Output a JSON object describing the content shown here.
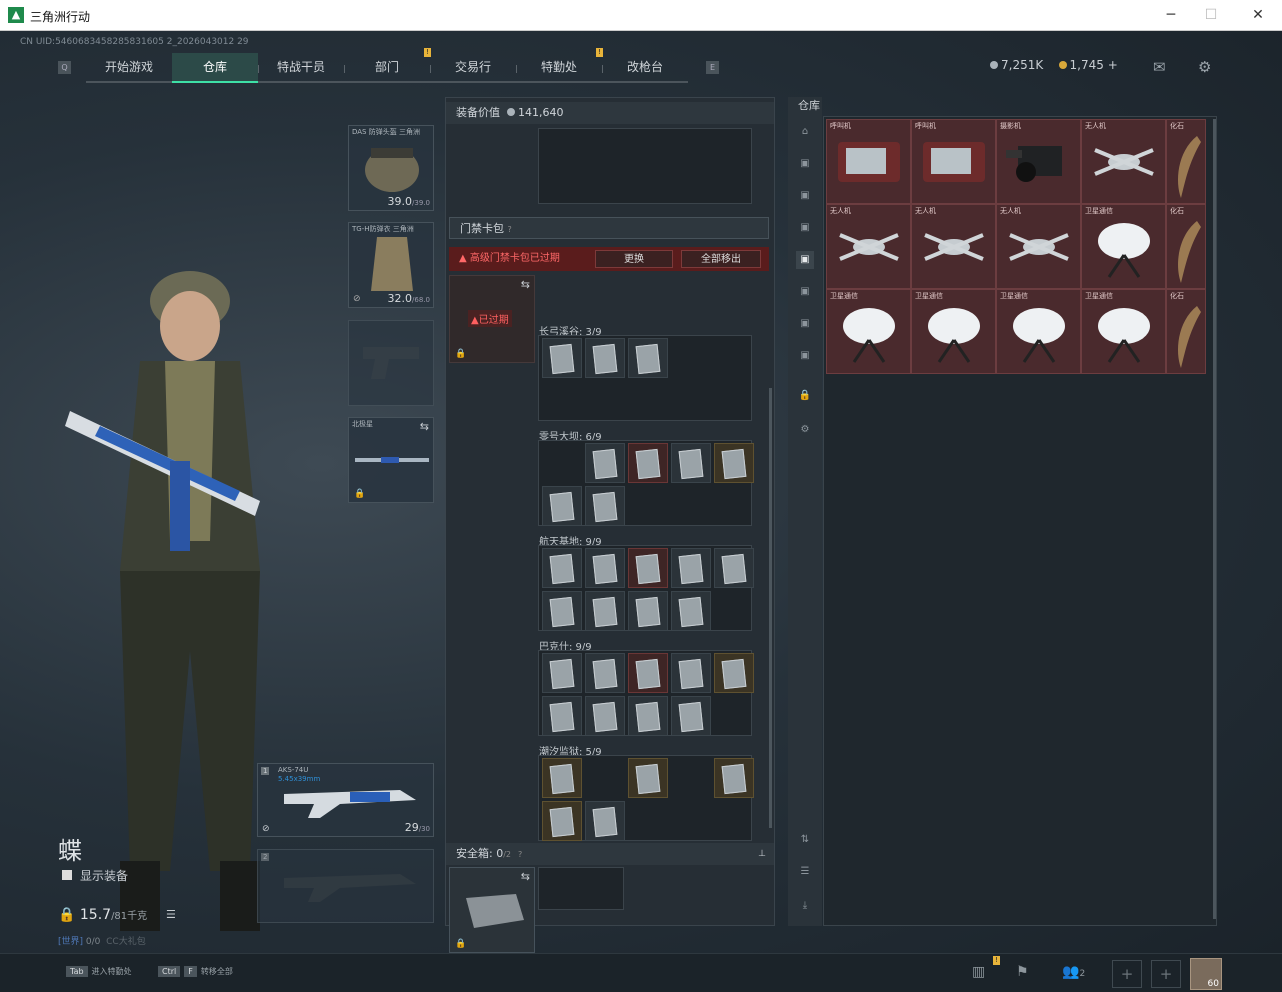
{
  "window": {
    "title": "三角洲行动"
  },
  "uid": "CN UID:5460683458285831605 2_2026043012 29",
  "nav": {
    "items": [
      "开始游戏",
      "仓库",
      "特战干员",
      "部门",
      "交易行",
      "特勤处",
      "改枪台"
    ],
    "active": 1,
    "badge": "!"
  },
  "currency": {
    "silver": "7,251K",
    "gold": "1,745",
    "gold_plus": "+"
  },
  "character": {
    "name": "蝶",
    "show_gear": "显示装备",
    "weight": "15.7",
    "weight_max": "/81千克",
    "channel": "[世界]",
    "channel_count": "0/0",
    "cc": "CC大礼包"
  },
  "equipment": {
    "helmet": {
      "name": "DAS 防弹头盔\n三角洲",
      "value": "39.0",
      "max": "/39.0"
    },
    "armor": {
      "name": "TG-H防弹衣\n三角洲",
      "value": "32.0",
      "max": "/68.0"
    },
    "melee": {
      "name": "北极星"
    },
    "weapon1": {
      "slot": "1",
      "name": "AKS-74U",
      "ammo": "5.45x39mm",
      "count": "29",
      "count_max": "/30"
    },
    "weapon2": {
      "slot": "2"
    }
  },
  "middle": {
    "value_label": "装备价值",
    "value": "141,640",
    "cardpack_label": "门禁卡包",
    "expired_warn": "高级门禁卡包已过期",
    "replace": "更换",
    "move_all": "全部移出",
    "expired_tag": "已过期",
    "areas": [
      {
        "name": "长弓溪谷: 3/9"
      },
      {
        "name": "零号大坝: 6/9"
      },
      {
        "name": "航天基地: 9/9"
      },
      {
        "name": "巴克什: 9/9"
      },
      {
        "name": "潮汐监狱: 5/9"
      }
    ],
    "safebox_label": "安全箱:",
    "safebox_count": "0",
    "safebox_max": "/2"
  },
  "stash": {
    "title": "仓库",
    "items": [
      {
        "label": "呼叫机",
        "kind": "radio"
      },
      {
        "label": "呼叫机",
        "kind": "radio"
      },
      {
        "label": "摄影机",
        "kind": "camera"
      },
      {
        "label": "无人机",
        "kind": "drone"
      },
      {
        "label": "化石",
        "kind": "fossil"
      },
      {
        "label": "无人机",
        "kind": "drone"
      },
      {
        "label": "无人机",
        "kind": "drone"
      },
      {
        "label": "无人机",
        "kind": "drone"
      },
      {
        "label": "卫星通信",
        "kind": "dish"
      },
      {
        "label": "化石",
        "kind": "fossil"
      },
      {
        "label": "卫星通信",
        "kind": "dish"
      },
      {
        "label": "卫星通信",
        "kind": "dish"
      },
      {
        "label": "卫星通信",
        "kind": "dish"
      },
      {
        "label": "卫星通信",
        "kind": "dish"
      },
      {
        "label": "化石",
        "kind": "fossil"
      }
    ]
  },
  "bottom": {
    "tab_key": "Tab",
    "tab_label": "进入特勤处",
    "ctrl_key": "Ctrl",
    "f_key": "F",
    "transfer_label": "转移全部",
    "friends": "2",
    "level": "60"
  }
}
